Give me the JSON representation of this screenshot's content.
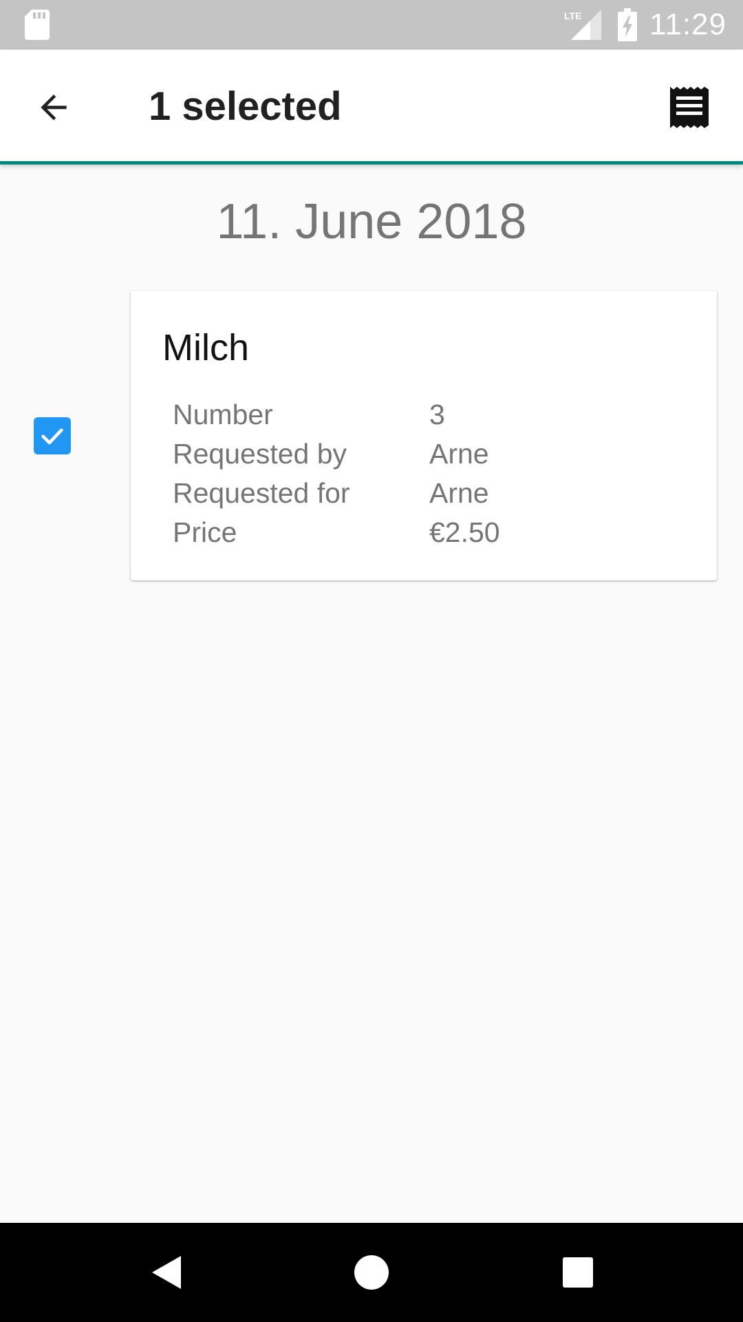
{
  "status_bar": {
    "time": "11:29",
    "network_label": "LTE",
    "icons": [
      "sd-card-icon",
      "lte-signal-icon",
      "battery-charging-icon"
    ]
  },
  "app_bar": {
    "title": "1 selected",
    "back_icon": "arrow-back-icon",
    "action_icon": "receipt-icon",
    "accent_color": "#00897b"
  },
  "date_header": "11. June 2018",
  "selection": {
    "checked": true,
    "checkbox_color": "#2196f3"
  },
  "card": {
    "title": "Milch",
    "rows": [
      {
        "label": "Number",
        "value": "3"
      },
      {
        "label": "Requested by",
        "value": "Arne"
      },
      {
        "label": "Requested for",
        "value": "Arne"
      },
      {
        "label": "Price",
        "value": "€2.50"
      }
    ]
  },
  "nav_bar": {
    "icons": [
      "nav-back-icon",
      "nav-home-icon",
      "nav-recents-icon"
    ]
  }
}
